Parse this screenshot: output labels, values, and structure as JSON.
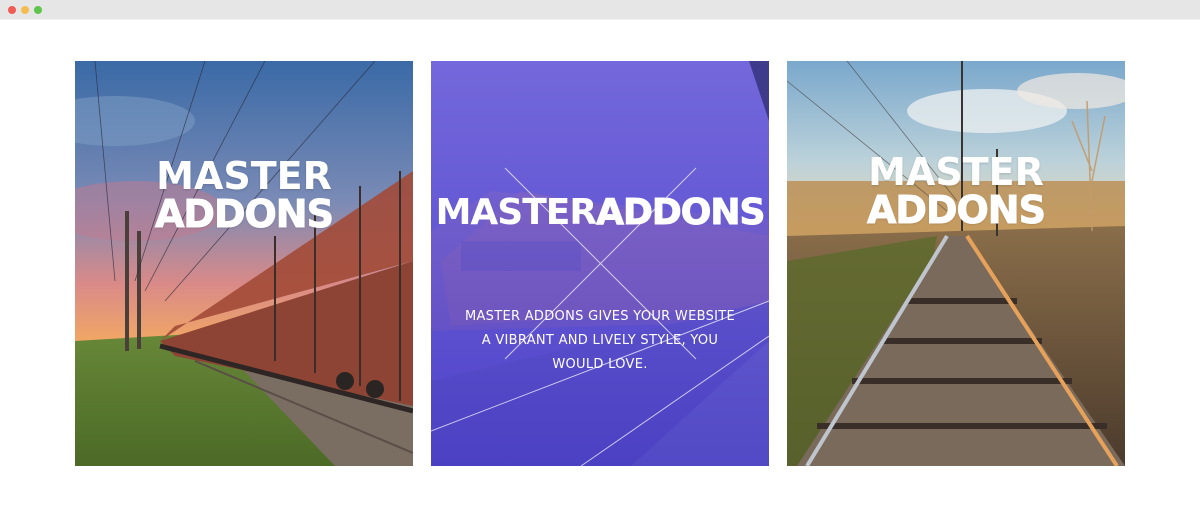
{
  "window": {
    "controls": {
      "close_color": "#ee5c54",
      "minimize_color": "#f5bd4f",
      "maximize_color": "#5ec54a"
    }
  },
  "cards": [
    {
      "title_line1": "MASTER",
      "title_line2": "ADDONS",
      "image": "freight-train-sunset"
    },
    {
      "title_word1": "MASTER",
      "title_word2": "ADDONS",
      "description": "MASTER ADDONS GIVES YOUR WEBSITE A VIBRANT AND LIVELY STYLE, YOU WOULD LOVE.",
      "image": "red-passenger-train-purple-overlay",
      "overlay_color": "#6a5bd8"
    },
    {
      "title_line1": "MASTER",
      "title_line2": "ADDONS",
      "image": "railway-tracks-golden-hour"
    }
  ]
}
